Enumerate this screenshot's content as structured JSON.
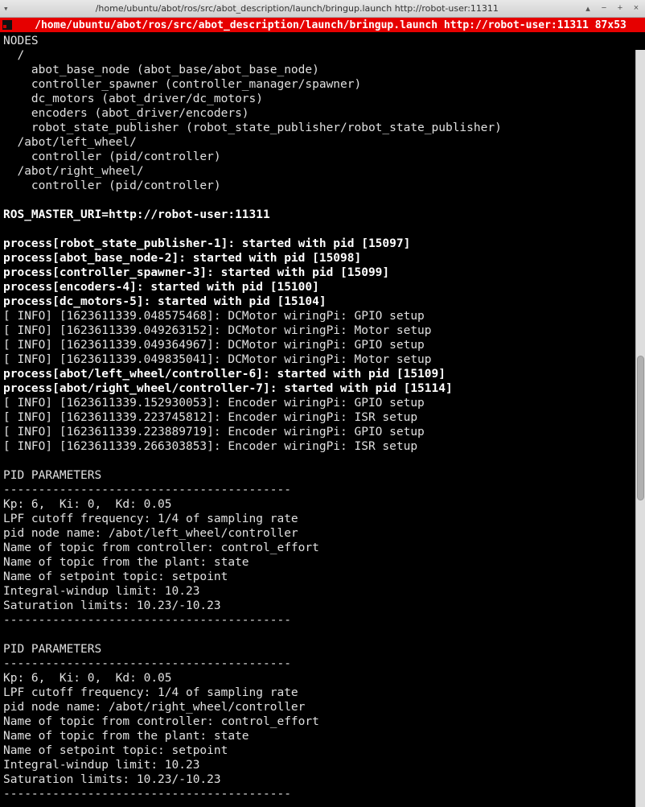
{
  "window": {
    "title": "/home/ubuntu/abot/ros/src/abot_description/launch/bringup.launch http://robot-user:11311"
  },
  "tab": {
    "label": "/home/ubuntu/abot/ros/src/abot_description/launch/bringup.launch http://robot-user:11311 87x53"
  },
  "lines": [
    {
      "bold": false,
      "text": "NODES"
    },
    {
      "bold": false,
      "text": "  /"
    },
    {
      "bold": false,
      "text": "    abot_base_node (abot_base/abot_base_node)"
    },
    {
      "bold": false,
      "text": "    controller_spawner (controller_manager/spawner)"
    },
    {
      "bold": false,
      "text": "    dc_motors (abot_driver/dc_motors)"
    },
    {
      "bold": false,
      "text": "    encoders (abot_driver/encoders)"
    },
    {
      "bold": false,
      "text": "    robot_state_publisher (robot_state_publisher/robot_state_publisher)"
    },
    {
      "bold": false,
      "text": "  /abot/left_wheel/"
    },
    {
      "bold": false,
      "text": "    controller (pid/controller)"
    },
    {
      "bold": false,
      "text": "  /abot/right_wheel/"
    },
    {
      "bold": false,
      "text": "    controller (pid/controller)"
    },
    {
      "bold": false,
      "text": ""
    },
    {
      "bold": true,
      "text": "ROS_MASTER_URI=http://robot-user:11311"
    },
    {
      "bold": false,
      "text": ""
    },
    {
      "bold": true,
      "text": "process[robot_state_publisher-1]: started with pid [15097]"
    },
    {
      "bold": true,
      "text": "process[abot_base_node-2]: started with pid [15098]"
    },
    {
      "bold": true,
      "text": "process[controller_spawner-3]: started with pid [15099]"
    },
    {
      "bold": true,
      "text": "process[encoders-4]: started with pid [15100]"
    },
    {
      "bold": true,
      "text": "process[dc_motors-5]: started with pid [15104]"
    },
    {
      "bold": false,
      "text": "[ INFO] [1623611339.048575468]: DCMotor wiringPi: GPIO setup"
    },
    {
      "bold": false,
      "text": "[ INFO] [1623611339.049263152]: DCMotor wiringPi: Motor setup"
    },
    {
      "bold": false,
      "text": "[ INFO] [1623611339.049364967]: DCMotor wiringPi: GPIO setup"
    },
    {
      "bold": false,
      "text": "[ INFO] [1623611339.049835041]: DCMotor wiringPi: Motor setup"
    },
    {
      "bold": true,
      "text": "process[abot/left_wheel/controller-6]: started with pid [15109]"
    },
    {
      "bold": true,
      "text": "process[abot/right_wheel/controller-7]: started with pid [15114]"
    },
    {
      "bold": false,
      "text": "[ INFO] [1623611339.152930053]: Encoder wiringPi: GPIO setup"
    },
    {
      "bold": false,
      "text": "[ INFO] [1623611339.223745812]: Encoder wiringPi: ISR setup"
    },
    {
      "bold": false,
      "text": "[ INFO] [1623611339.223889719]: Encoder wiringPi: GPIO setup"
    },
    {
      "bold": false,
      "text": "[ INFO] [1623611339.266303853]: Encoder wiringPi: ISR setup"
    },
    {
      "bold": false,
      "text": ""
    },
    {
      "bold": false,
      "text": "PID PARAMETERS"
    },
    {
      "bold": false,
      "text": "-----------------------------------------"
    },
    {
      "bold": false,
      "text": "Kp: 6,  Ki: 0,  Kd: 0.05"
    },
    {
      "bold": false,
      "text": "LPF cutoff frequency: 1/4 of sampling rate"
    },
    {
      "bold": false,
      "text": "pid node name: /abot/left_wheel/controller"
    },
    {
      "bold": false,
      "text": "Name of topic from controller: control_effort"
    },
    {
      "bold": false,
      "text": "Name of topic from the plant: state"
    },
    {
      "bold": false,
      "text": "Name of setpoint topic: setpoint"
    },
    {
      "bold": false,
      "text": "Integral-windup limit: 10.23"
    },
    {
      "bold": false,
      "text": "Saturation limits: 10.23/-10.23"
    },
    {
      "bold": false,
      "text": "-----------------------------------------"
    },
    {
      "bold": false,
      "text": ""
    },
    {
      "bold": false,
      "text": "PID PARAMETERS"
    },
    {
      "bold": false,
      "text": "-----------------------------------------"
    },
    {
      "bold": false,
      "text": "Kp: 6,  Ki: 0,  Kd: 0.05"
    },
    {
      "bold": false,
      "text": "LPF cutoff frequency: 1/4 of sampling rate"
    },
    {
      "bold": false,
      "text": "pid node name: /abot/right_wheel/controller"
    },
    {
      "bold": false,
      "text": "Name of topic from controller: control_effort"
    },
    {
      "bold": false,
      "text": "Name of topic from the plant: state"
    },
    {
      "bold": false,
      "text": "Name of setpoint topic: setpoint"
    },
    {
      "bold": false,
      "text": "Integral-windup limit: 10.23"
    },
    {
      "bold": false,
      "text": "Saturation limits: 10.23/-10.23"
    },
    {
      "bold": false,
      "text": "-----------------------------------------"
    }
  ]
}
